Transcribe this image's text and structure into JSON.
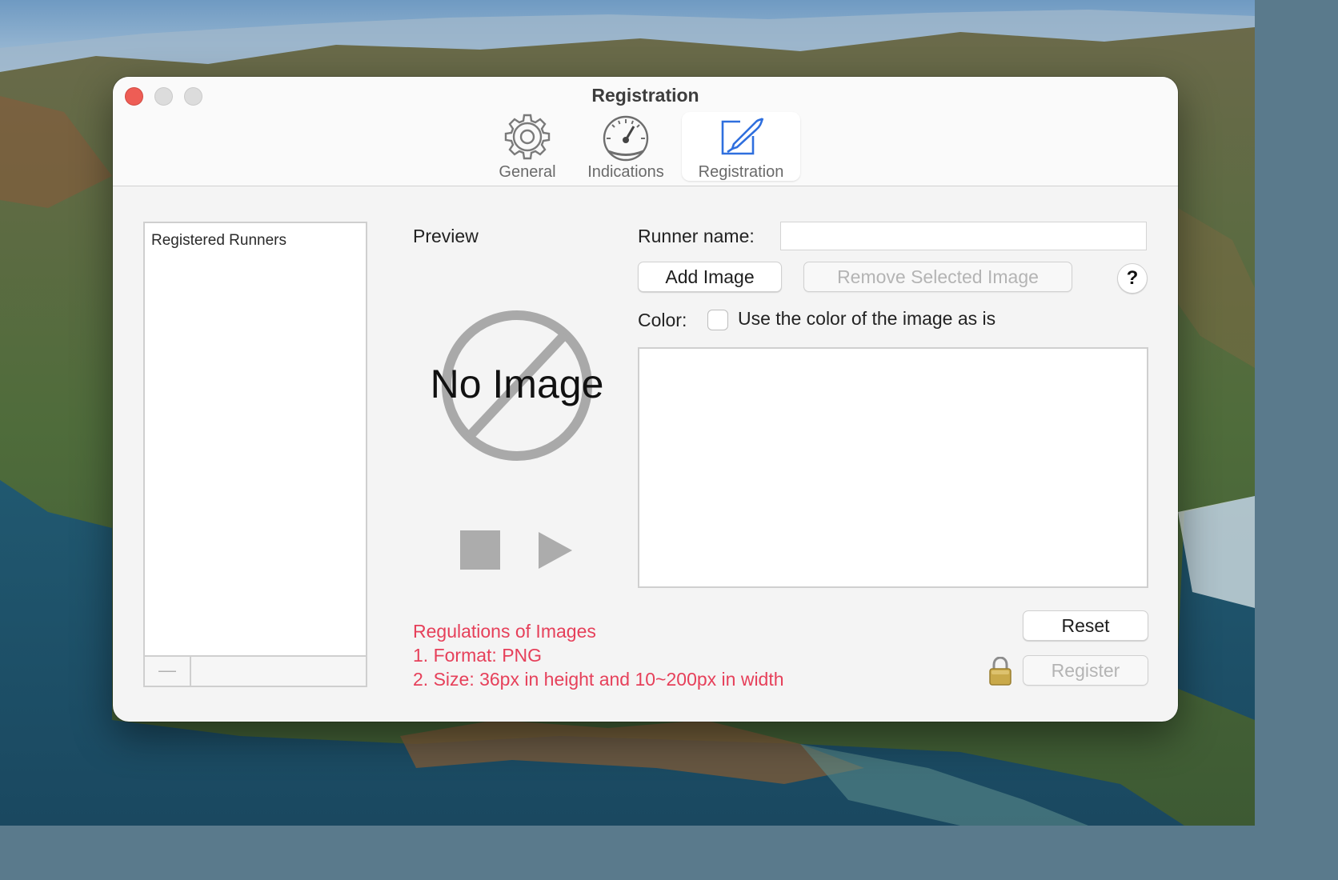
{
  "window": {
    "title": "Registration"
  },
  "toolbar": {
    "tabs": [
      {
        "label": "General",
        "icon": "gear-icon"
      },
      {
        "label": "Indications",
        "icon": "speedometer-icon"
      },
      {
        "label": "Registration",
        "icon": "edit-pen-icon",
        "selected": true
      }
    ]
  },
  "sidebar": {
    "header": "Registered Runners",
    "remove_button": "—"
  },
  "preview": {
    "label": "Preview",
    "placeholder_text": "No Image"
  },
  "form": {
    "runner_name_label": "Runner name:",
    "runner_name_value": "",
    "add_image_label": "Add Image",
    "remove_image_label": "Remove Selected Image",
    "help_label": "?",
    "color_label": "Color:",
    "use_color_label": "Use the color of the image as is",
    "use_color_checked": false
  },
  "regulations": {
    "title": "Regulations of Images",
    "rule1": "1. Format: PNG",
    "rule2": "2. Size: 36px in height and 10~200px in width"
  },
  "actions": {
    "reset_label": "Reset",
    "register_label": "Register"
  },
  "colors": {
    "accent": "#2f6fde",
    "rules_text": "#e6405a",
    "close_button": "#ee5d55"
  }
}
